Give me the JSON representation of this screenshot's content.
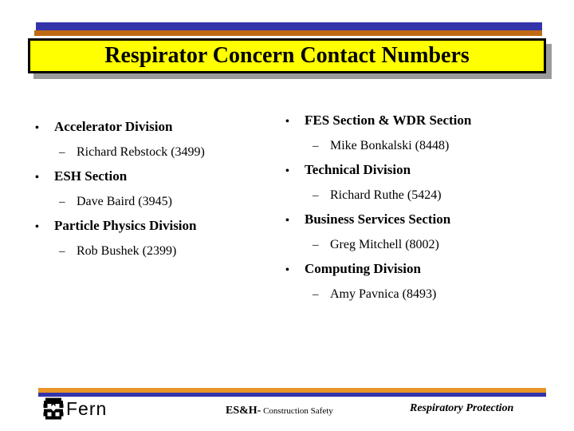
{
  "slide": {
    "title": "Respirator Concern Contact Numbers",
    "colors": {
      "title_fill": "#ffff00",
      "title_border": "#000000",
      "title_shadow": "#9b9b9b",
      "rule_blue": "#3333aa",
      "rule_orange_header": "#c06a16",
      "rule_orange_footer": "#e8952a",
      "background": "#ffffff",
      "text": "#000000"
    }
  },
  "content": {
    "left_column": [
      {
        "level": 1,
        "marker": "•",
        "text": "Accelerator Division"
      },
      {
        "level": 2,
        "marker": "–",
        "text": "Richard Rebstock (3499)"
      },
      {
        "level": 1,
        "marker": "•",
        "text": "ESH Section"
      },
      {
        "level": 2,
        "marker": "–",
        "text": "Dave Baird (3945)"
      },
      {
        "level": 1,
        "marker": "•",
        "text": "Particle Physics Division"
      },
      {
        "level": 2,
        "marker": "–",
        "text": "Rob Bushek (2399)"
      }
    ],
    "right_column": [
      {
        "level": 1,
        "marker": "•",
        "text": "FES Section & WDR Section"
      },
      {
        "level": 2,
        "marker": "–",
        "text": "Mike Bonkalski (8448)"
      },
      {
        "level": 1,
        "marker": "•",
        "text": "Technical Division"
      },
      {
        "level": 2,
        "marker": "–",
        "text": "Richard Ruthe (5424)"
      },
      {
        "level": 1,
        "marker": "•",
        "text": "Business Services Section"
      },
      {
        "level": 2,
        "marker": "–",
        "text": "Greg Mitchell (8002)"
      },
      {
        "level": 1,
        "marker": "•",
        "text": "Computing Division"
      },
      {
        "level": 2,
        "marker": "–",
        "text": "Amy Pavnica (8493)"
      }
    ]
  },
  "footer": {
    "logo_text": "Fern",
    "logo_icon": "fern-clover-mark-icon",
    "center_primary": "ES&H-",
    "center_secondary": "Construction Safety",
    "right_label": "Respiratory Protection"
  }
}
